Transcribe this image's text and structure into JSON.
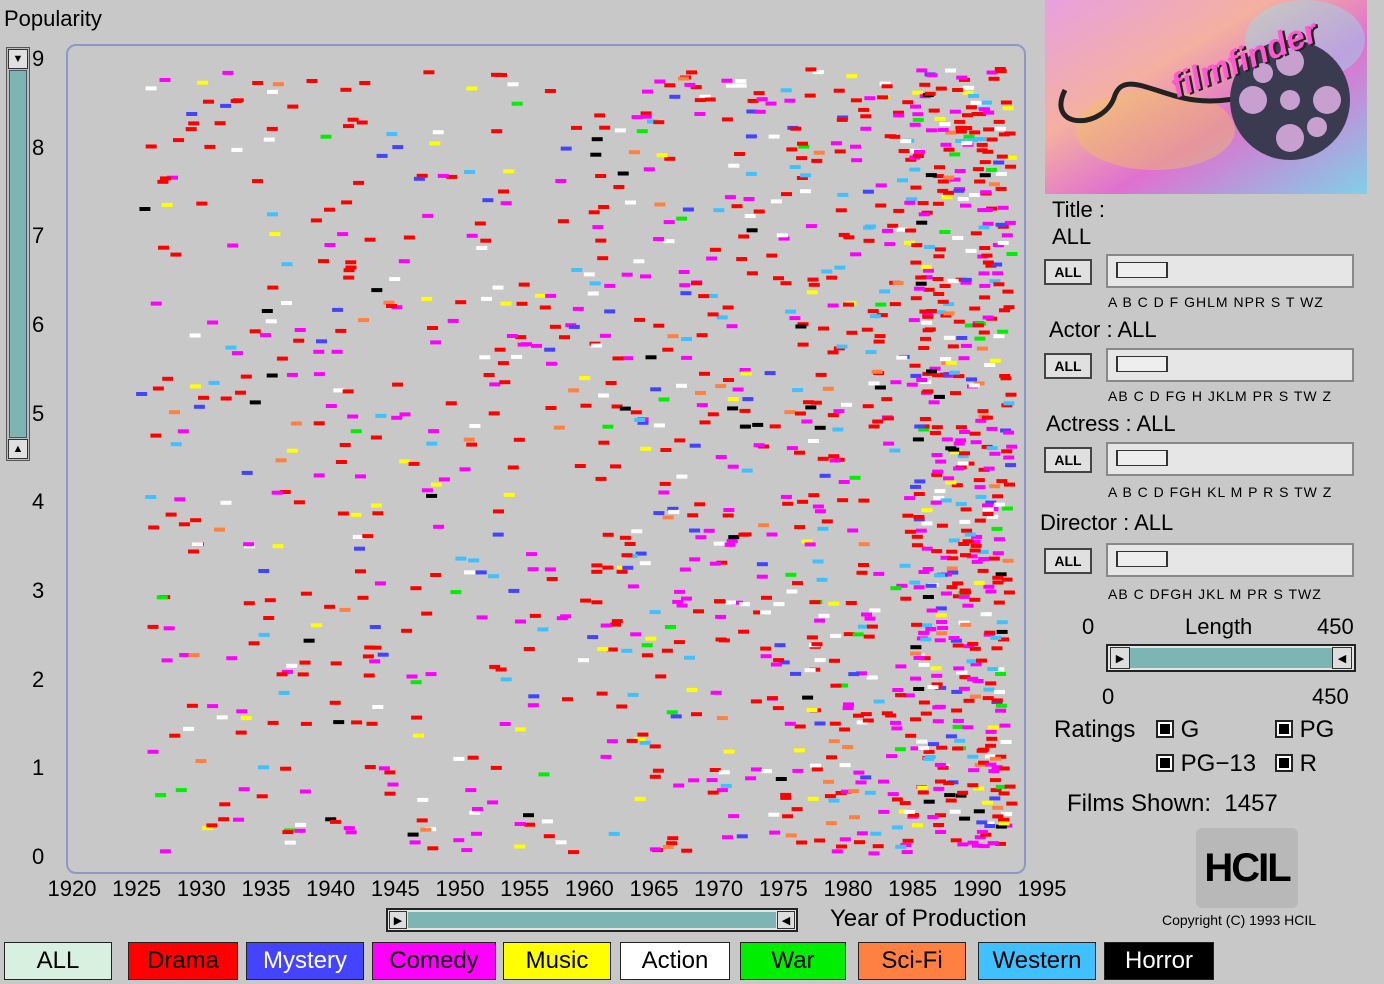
{
  "yaxis": {
    "label": "Popularity",
    "ticks": [
      "0",
      "1",
      "2",
      "3",
      "4",
      "5",
      "6",
      "7",
      "8",
      "9"
    ]
  },
  "xaxis": {
    "label": "Year of Production",
    "ticks": [
      "1920",
      "1925",
      "1930",
      "1935",
      "1940",
      "1945",
      "1950",
      "1955",
      "1960",
      "1965",
      "1970",
      "1975",
      "1980",
      "1985",
      "1990",
      "1995"
    ]
  },
  "scatter": {
    "year_range": [
      1920,
      1995
    ],
    "popularity_range": [
      0,
      9
    ],
    "points_visible": 1457
  },
  "colors": {
    "Drama": "#ff0000",
    "Mystery": "#4444ff",
    "Comedy": "#ff00ff",
    "Music": "#ffff00",
    "Action": "#ffffff",
    "War": "#00ee00",
    "Sci-Fi": "#ff8040",
    "Western": "#40c0ff",
    "Horror": "#000000",
    "ALL": "#d8f0e0"
  },
  "logo": {
    "text": "filmfinder"
  },
  "filters": {
    "title": {
      "label": "Title :",
      "value": "ALL",
      "button": "ALL",
      "letters": "A B C D F GHLM NPR S  T  WZ"
    },
    "actor": {
      "label": "Actor : ALL",
      "button": "ALL",
      "letters": "AB  C  D FG H JKLM   PR S  TW Z"
    },
    "actress": {
      "label": "Actress : ALL",
      "button": "ALL",
      "letters": "A B  C  D FGH KL M   P R S  TW Z"
    },
    "director": {
      "label": "Director : ALL",
      "button": "ALL",
      "letters": "AB  C DFGH JKL M   PR S  TWZ"
    }
  },
  "length": {
    "label": "Length",
    "min_top": "0",
    "max_top": "450",
    "min_bottom": "0",
    "max_bottom": "450"
  },
  "ratings": {
    "label": "Ratings",
    "options": [
      "G",
      "PG",
      "PG−13",
      "R"
    ]
  },
  "films_shown": {
    "label": "Films Shown:",
    "value": "1457"
  },
  "hcil": {
    "logo_text": "HCIL",
    "copyright": "Copyright (C) 1993 HCIL"
  },
  "genres": [
    "ALL",
    "Drama",
    "Mystery",
    "Comedy",
    "Music",
    "Action",
    "War",
    "Sci-Fi",
    "Western",
    "Horror"
  ]
}
